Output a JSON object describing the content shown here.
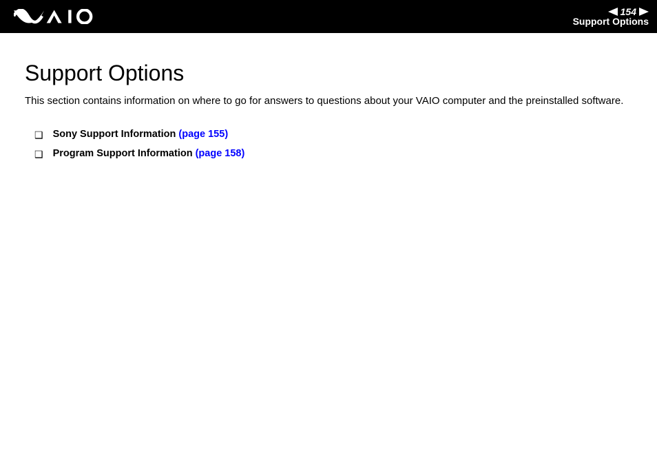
{
  "header": {
    "page_number": "154",
    "subtitle": "Support Options"
  },
  "content": {
    "title": "Support Options",
    "intro": "This section contains information on where to go for answers to questions about your VAIO computer and the preinstalled software.",
    "items": [
      {
        "label": "Sony Support Information ",
        "link_text": "(page 155)"
      },
      {
        "label": "Program Support Information ",
        "link_text": "(page 158)"
      }
    ]
  }
}
